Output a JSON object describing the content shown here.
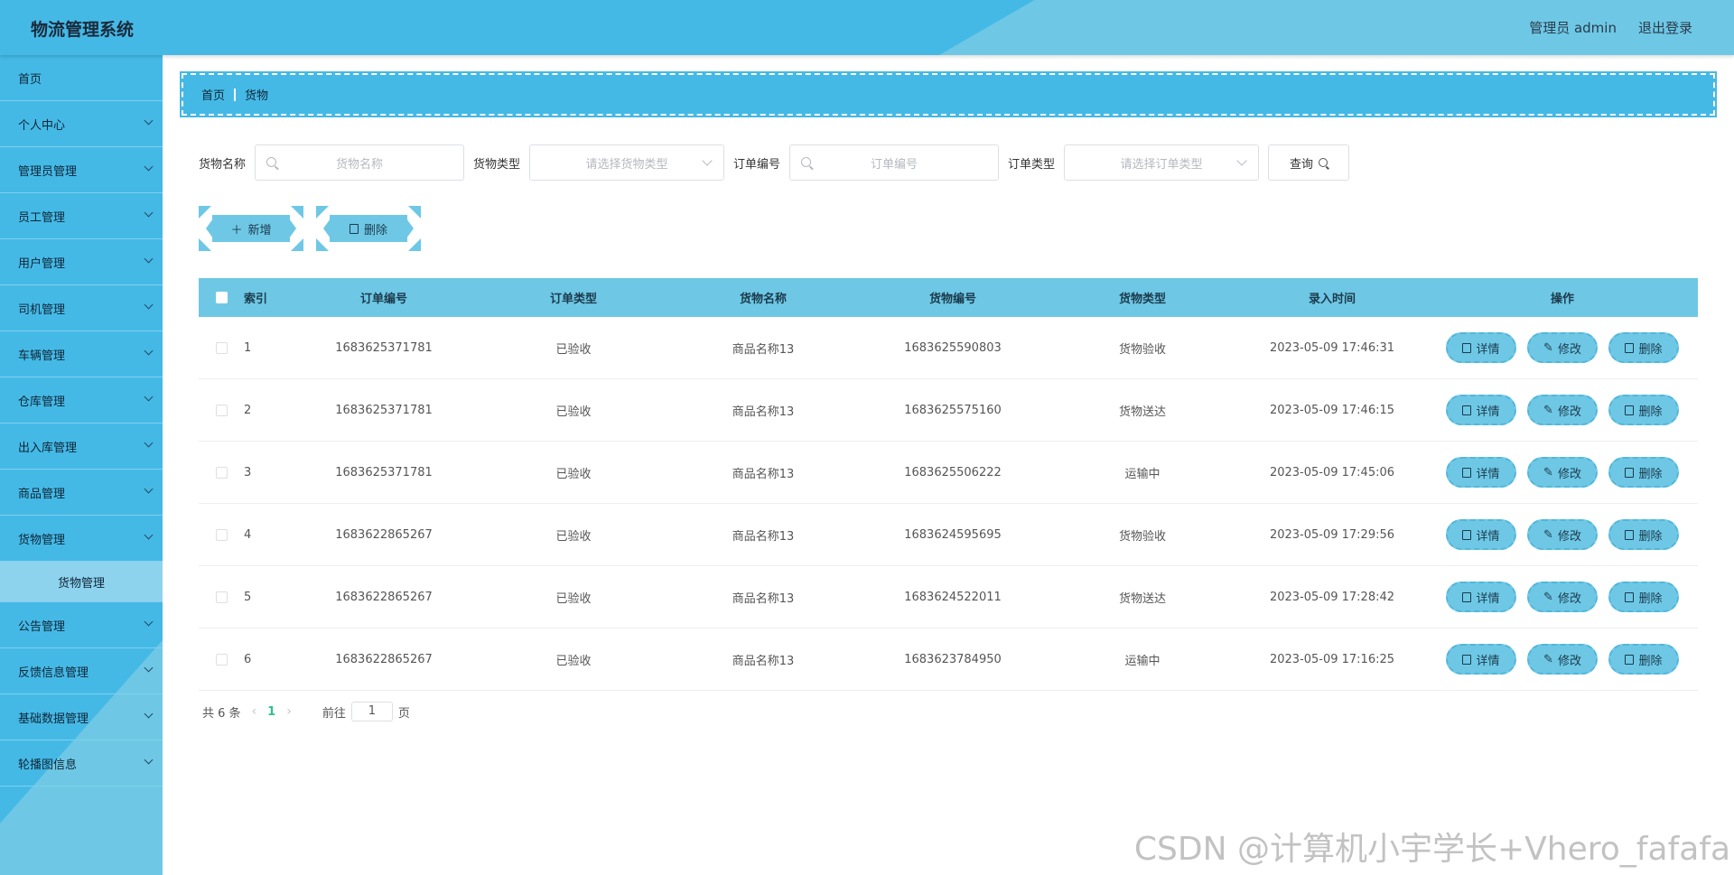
{
  "header": {
    "title": "物流管理系统",
    "user_label": "管理员 admin",
    "logout_label": "退出登录"
  },
  "sidebar": {
    "items": [
      {
        "label": "首页"
      },
      {
        "label": "个人中心"
      },
      {
        "label": "管理员管理"
      },
      {
        "label": "员工管理"
      },
      {
        "label": "用户管理"
      },
      {
        "label": "司机管理"
      },
      {
        "label": "车辆管理"
      },
      {
        "label": "仓库管理"
      },
      {
        "label": "出入库管理"
      },
      {
        "label": "商品管理"
      },
      {
        "label": "货物管理"
      },
      {
        "label": "公告管理"
      },
      {
        "label": "反馈信息管理"
      },
      {
        "label": "基础数据管理"
      },
      {
        "label": "轮播图信息"
      }
    ],
    "active_sub": "货物管理"
  },
  "breadcrumb": {
    "home": "首页",
    "current": "货物"
  },
  "search": {
    "goods_name_label": "货物名称",
    "goods_name_placeholder": "货物名称",
    "goods_type_label": "货物类型",
    "goods_type_placeholder": "请选择货物类型",
    "order_no_label": "订单编号",
    "order_no_placeholder": "订单编号",
    "order_type_label": "订单类型",
    "order_type_placeholder": "请选择订单类型",
    "query_label": "查询"
  },
  "actions": {
    "add_label": "新增",
    "delete_label": "删除"
  },
  "table": {
    "columns": [
      "索引",
      "订单编号",
      "订单类型",
      "货物名称",
      "货物编号",
      "货物类型",
      "录入时间",
      "操作"
    ],
    "rows": [
      {
        "index": "1",
        "order_no": "1683625371781",
        "order_type": "已验收",
        "goods_name": "商品名称13",
        "goods_no": "1683625590803",
        "goods_type": "货物验收",
        "time": "2023-05-09 17:46:31"
      },
      {
        "index": "2",
        "order_no": "1683625371781",
        "order_type": "已验收",
        "goods_name": "商品名称13",
        "goods_no": "1683625575160",
        "goods_type": "货物送达",
        "time": "2023-05-09 17:46:15"
      },
      {
        "index": "3",
        "order_no": "1683625371781",
        "order_type": "已验收",
        "goods_name": "商品名称13",
        "goods_no": "1683625506222",
        "goods_type": "运输中",
        "time": "2023-05-09 17:45:06"
      },
      {
        "index": "4",
        "order_no": "1683622865267",
        "order_type": "已验收",
        "goods_name": "商品名称13",
        "goods_no": "1683624595695",
        "goods_type": "货物验收",
        "time": "2023-05-09 17:29:56"
      },
      {
        "index": "5",
        "order_no": "1683622865267",
        "order_type": "已验收",
        "goods_name": "商品名称13",
        "goods_no": "1683624522011",
        "goods_type": "货物送达",
        "time": "2023-05-09 17:28:42"
      },
      {
        "index": "6",
        "order_no": "1683622865267",
        "order_type": "已验收",
        "goods_name": "商品名称13",
        "goods_no": "1683623784950",
        "goods_type": "运输中",
        "time": "2023-05-09 17:16:25"
      }
    ],
    "op_detail": "详情",
    "op_edit": "修改",
    "op_delete": "删除"
  },
  "pagination": {
    "total_label": "共 6 条",
    "current_page": "1",
    "goto_label": "前往",
    "goto_value": "1",
    "page_suffix": "页"
  },
  "watermark": "CSDN @计算机小宇学长+Vhero_fafafa",
  "colors": {
    "primary": "#45b9e6",
    "accent": "#6ec8e5",
    "page_active": "#2ebf91"
  }
}
